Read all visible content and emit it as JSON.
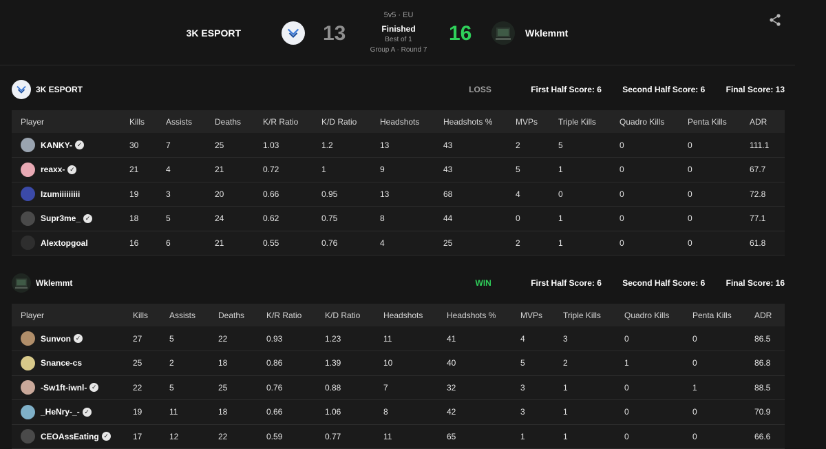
{
  "header": {
    "team_left": "3K ESPORT",
    "team_right": "Wklemmt",
    "score_left": "13",
    "score_right": "16",
    "mode": "5v5 · EU",
    "status": "Finished",
    "best_of": "Best of 1",
    "round": "Group A · Round 7"
  },
  "colors": {
    "win": "#2fd05a",
    "loss_score": "#8e8e8e",
    "bg": "#161616"
  },
  "icons": {
    "share": "share-icon",
    "verified": "verified-icon"
  },
  "columns": [
    "Player",
    "Kills",
    "Assists",
    "Deaths",
    "K/R Ratio",
    "K/D Ratio",
    "Headshots",
    "Headshots %",
    "MVPs",
    "Triple Kills",
    "Quadro Kills",
    "Penta Kills",
    "ADR"
  ],
  "teams": [
    {
      "name": "3K ESPORT",
      "result": "LOSS",
      "first_half": "First Half Score: 6",
      "second_half": "Second Half Score: 6",
      "final": "Final Score: 13",
      "players": [
        {
          "name": "KANKY-",
          "verified": true,
          "avatar_color": "#9aa4b0",
          "stats": [
            "30",
            "7",
            "25",
            "1.03",
            "1.2",
            "13",
            "43",
            "2",
            "5",
            "0",
            "0",
            "111.1"
          ]
        },
        {
          "name": "reaxx-",
          "verified": true,
          "avatar_color": "#e8a9b4",
          "stats": [
            "21",
            "4",
            "21",
            "0.72",
            "1",
            "9",
            "43",
            "5",
            "1",
            "0",
            "0",
            "67.7"
          ]
        },
        {
          "name": "Izumiiiiiiiii",
          "verified": false,
          "avatar_color": "#3b4aa8",
          "stats": [
            "19",
            "3",
            "20",
            "0.66",
            "0.95",
            "13",
            "68",
            "4",
            "0",
            "0",
            "0",
            "72.8"
          ]
        },
        {
          "name": "Supr3me_",
          "verified": true,
          "avatar_color": "#4a4a4a",
          "stats": [
            "18",
            "5",
            "24",
            "0.62",
            "0.75",
            "8",
            "44",
            "0",
            "1",
            "0",
            "0",
            "77.1"
          ]
        },
        {
          "name": "Alextopgoal",
          "verified": false,
          "avatar_color": "#2e2e2e",
          "stats": [
            "16",
            "6",
            "21",
            "0.55",
            "0.76",
            "4",
            "25",
            "2",
            "1",
            "0",
            "0",
            "61.8"
          ]
        }
      ]
    },
    {
      "name": "Wklemmt",
      "result": "WIN",
      "first_half": "First Half Score: 6",
      "second_half": "Second Half Score: 6",
      "final": "Final Score: 16",
      "players": [
        {
          "name": "Sunvon",
          "verified": true,
          "avatar_color": "#b08e6a",
          "stats": [
            "27",
            "5",
            "22",
            "0.93",
            "1.23",
            "11",
            "41",
            "4",
            "3",
            "0",
            "0",
            "86.5"
          ]
        },
        {
          "name": "Snance-cs",
          "verified": false,
          "avatar_color": "#d8c98a",
          "stats": [
            "25",
            "2",
            "18",
            "0.86",
            "1.39",
            "10",
            "40",
            "5",
            "2",
            "1",
            "0",
            "86.8"
          ]
        },
        {
          "name": "-Sw1ft-iwnl-",
          "verified": true,
          "avatar_color": "#c9a89a",
          "stats": [
            "22",
            "5",
            "25",
            "0.76",
            "0.88",
            "7",
            "32",
            "3",
            "1",
            "0",
            "1",
            "88.5"
          ]
        },
        {
          "name": "_HeNry-_-",
          "verified": true,
          "avatar_color": "#7fb0c8",
          "stats": [
            "19",
            "11",
            "18",
            "0.66",
            "1.06",
            "8",
            "42",
            "3",
            "1",
            "0",
            "0",
            "70.9"
          ]
        },
        {
          "name": "CEOAssEating",
          "verified": true,
          "avatar_color": "#4a4a4a",
          "stats": [
            "17",
            "12",
            "22",
            "0.59",
            "0.77",
            "11",
            "65",
            "1",
            "1",
            "0",
            "0",
            "66.6"
          ]
        }
      ]
    }
  ]
}
